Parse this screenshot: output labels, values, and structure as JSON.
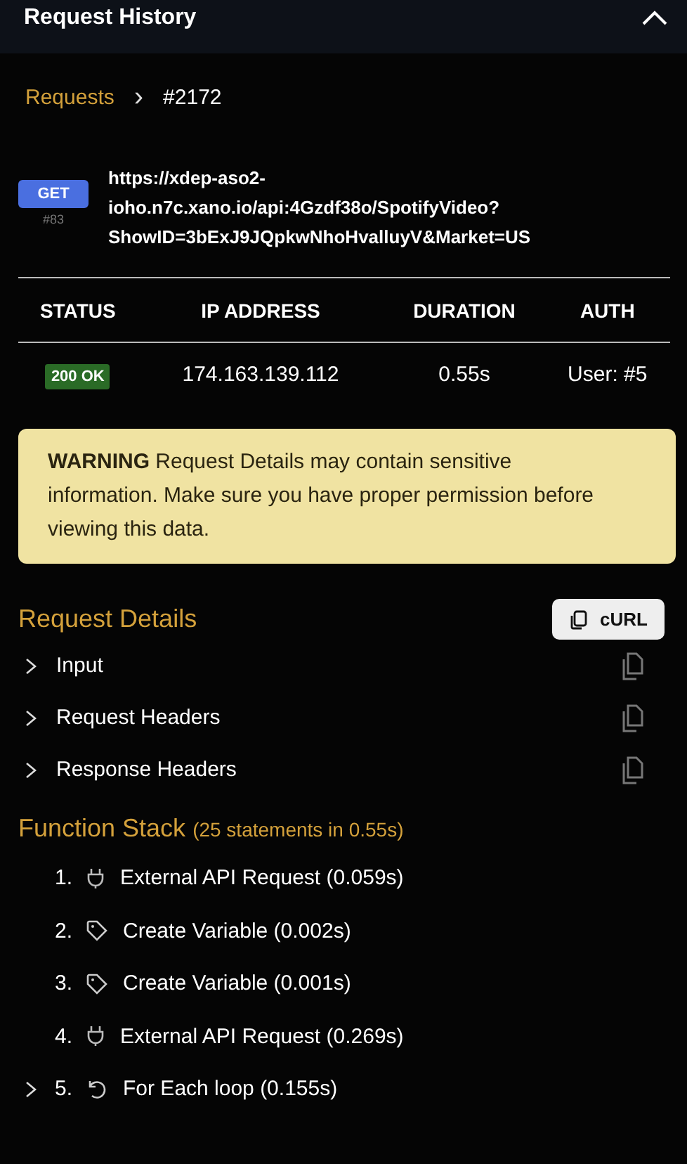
{
  "window": {
    "title": "Request History"
  },
  "breadcrumb": {
    "parent": "Requests",
    "separator": "›",
    "current": "#2172"
  },
  "request": {
    "method": "GET",
    "id": "#83",
    "url": "https://xdep-aso2-ioho.n7c.xano.io/api:4Gzdf38o/SpotifyVideo?ShowID=3bExJ9JQpkwNhoHvalluyV&Market=US"
  },
  "table": {
    "columns": [
      "STATUS",
      "IP ADDRESS",
      "DURATION",
      "AUTH"
    ],
    "rows": [
      {
        "status": "200 OK",
        "ip": "174.163.139.112",
        "duration": "0.55s",
        "auth": "User: #5"
      }
    ]
  },
  "warning": {
    "label": "WARNING",
    "text": "Request Details may contain sensitive information. Make sure you have proper permission before viewing this data."
  },
  "request_details": {
    "title": "Request Details",
    "curl_button": "cURL",
    "sections": [
      {
        "label": "Input",
        "expanded": false
      },
      {
        "label": "Request Headers",
        "expanded": false
      },
      {
        "label": "Response Headers",
        "expanded": false
      }
    ]
  },
  "function_stack": {
    "title": "Function Stack",
    "summary": "(25 statements in 0.55s)",
    "items": [
      {
        "number": "1.",
        "kind": "plug",
        "label": "External API Request (0.059s)",
        "expandable": false
      },
      {
        "number": "2.",
        "kind": "tag",
        "label": "Create Variable (0.002s)",
        "expandable": false
      },
      {
        "number": "3.",
        "kind": "tag",
        "label": "Create Variable (0.001s)",
        "expandable": false
      },
      {
        "number": "4.",
        "kind": "plug",
        "label": "External API Request (0.269s)",
        "expandable": false
      },
      {
        "number": "5.",
        "kind": "loop",
        "label": "For Each loop (0.155s)",
        "expandable": true
      }
    ]
  }
}
